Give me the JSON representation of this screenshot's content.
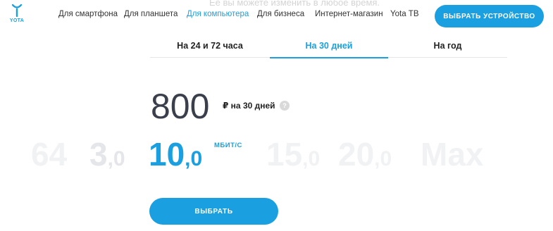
{
  "header": {
    "logo_text": "YOTA",
    "obscured_text": "Её вы можете изменить в любое время.",
    "nav": [
      {
        "label": "Для смартфона",
        "active": false
      },
      {
        "label": "Для планшета",
        "active": false
      },
      {
        "label": "Для компьютера",
        "active": true
      },
      {
        "label": "Для бизнеса",
        "active": false
      },
      {
        "label": "Интернет-магазин",
        "active": false
      },
      {
        "label": "Yota ТВ",
        "active": false
      }
    ],
    "select_device_label": "ВЫБРАТЬ УСТРОЙСТВО"
  },
  "tabs": [
    {
      "label": "На 24 и 72 часа",
      "active": false
    },
    {
      "label": "На 30 дней",
      "active": true
    },
    {
      "label": "На год",
      "active": false
    }
  ],
  "tariff": {
    "price": "800",
    "price_period": "₽ на 30 дней",
    "help_icon": "?"
  },
  "speed_options": [
    {
      "int": "64",
      "frac": "",
      "selected": false
    },
    {
      "int": "3",
      "frac": ",0",
      "selected": false
    },
    {
      "int": "10",
      "frac": ",0",
      "selected": true
    },
    {
      "int": "15",
      "frac": ",0",
      "selected": false
    },
    {
      "int": "20",
      "frac": ",0",
      "selected": false
    },
    {
      "int": "Max",
      "frac": "",
      "selected": false
    }
  ],
  "speed_unit": "МБИТ/С",
  "choose_button_label": "ВЫБРАТЬ",
  "colors": {
    "accent": "#1aa0e0",
    "price_text": "#3a3f4b",
    "inactive_speed": "#f1f2f4"
  }
}
